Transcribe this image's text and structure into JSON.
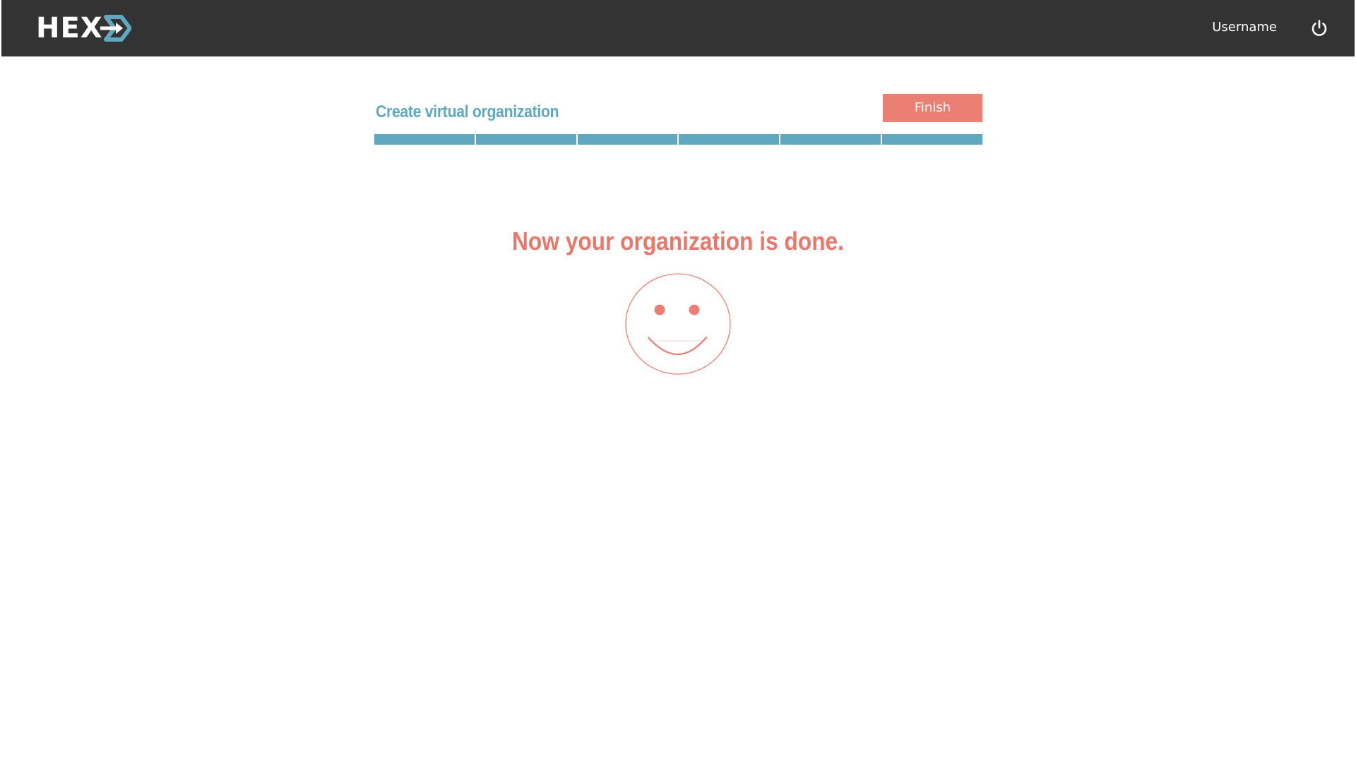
{
  "header": {
    "logo_text": "HEX",
    "logo_alt": "HEXAA",
    "username": "Username",
    "logout_icon": "power-icon"
  },
  "wizard": {
    "title": "Create virtual organization",
    "finish_label": "Finish",
    "progress_steps_total": 6,
    "progress_steps_completed": 6
  },
  "main": {
    "message": "Now your organization is done.",
    "illustration_icon": "smiley-face-icon"
  },
  "colors": {
    "header_bg": "#333333",
    "primary_blue": "#5fa8c0",
    "accent_coral": "#ec7f73",
    "text_white": "#ffffff"
  }
}
